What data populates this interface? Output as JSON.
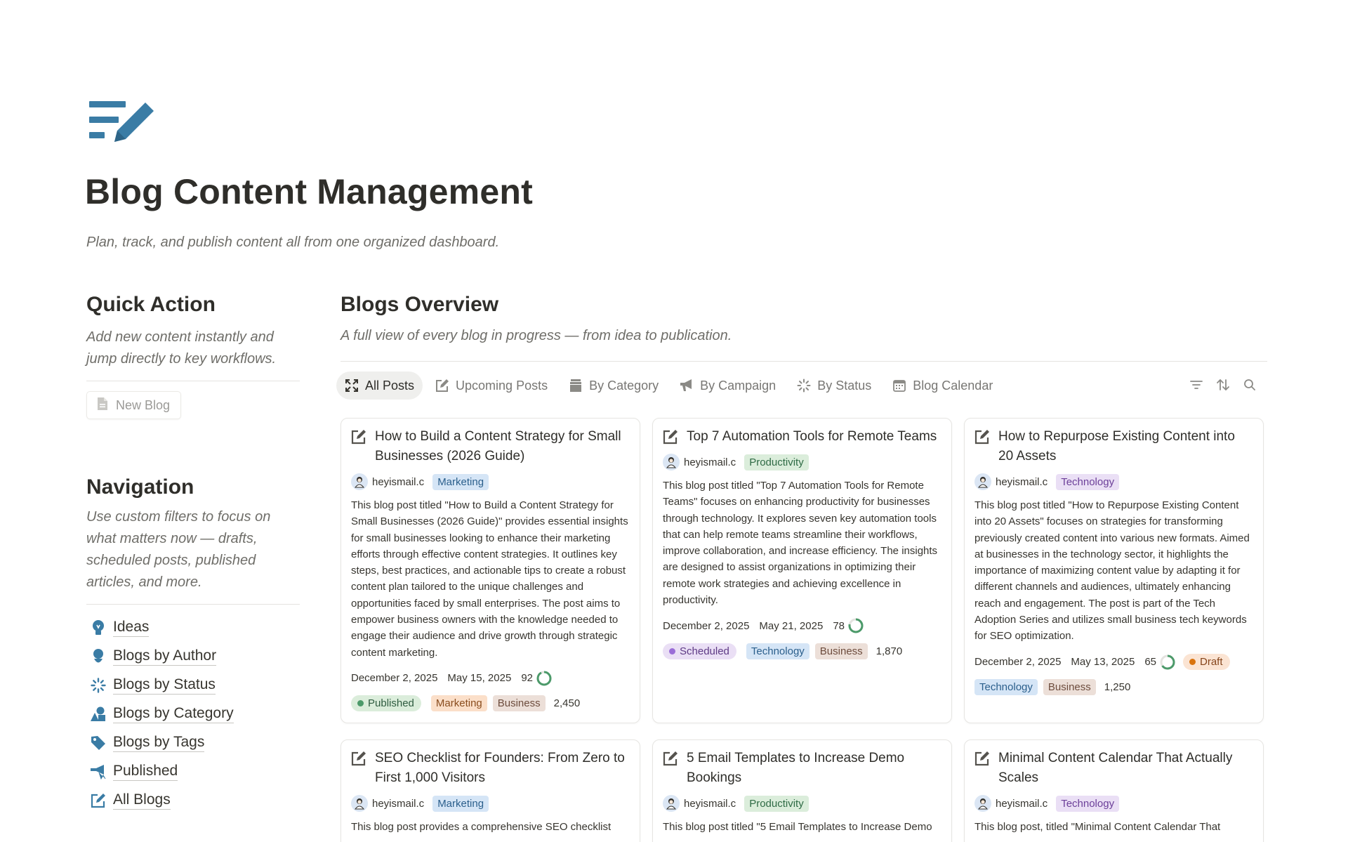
{
  "page": {
    "icon": "edit-list-icon",
    "title": "Blog Content Management",
    "subtitle": "Plan, track, and publish content all from one organized dashboard."
  },
  "quick_action": {
    "title": "Quick Action",
    "description": "Add new content instantly and jump directly to key workflows.",
    "new_blog_label": "New Blog"
  },
  "navigation": {
    "title": "Navigation",
    "description": "Use custom filters to focus on what matters now — drafts, scheduled posts, published articles, and more.",
    "items": [
      {
        "label": "Ideas",
        "icon": "lightbulb-icon"
      },
      {
        "label": "Blogs by Author",
        "icon": "person-icon"
      },
      {
        "label": "Blogs by Status",
        "icon": "loading-icon"
      },
      {
        "label": "Blogs by Category",
        "icon": "shapes-icon"
      },
      {
        "label": "Blogs by Tags",
        "icon": "tag-icon"
      },
      {
        "label": "Published",
        "icon": "megaphone-icon"
      },
      {
        "label": "All Blogs",
        "icon": "edit-icon"
      }
    ]
  },
  "overview": {
    "title": "Blogs Overview",
    "description": "A full view of every blog in progress — from idea to publication.",
    "tabs": [
      {
        "label": "All Posts",
        "icon": "expand-icon",
        "active": true
      },
      {
        "label": "Upcoming Posts",
        "icon": "edit-icon",
        "active": false
      },
      {
        "label": "By Category",
        "icon": "archive-icon",
        "active": false
      },
      {
        "label": "By Campaign",
        "icon": "megaphone-icon",
        "active": false
      },
      {
        "label": "By Status",
        "icon": "loading-icon",
        "active": false
      },
      {
        "label": "Blog Calendar",
        "icon": "calendar-icon",
        "active": false
      }
    ],
    "tools": [
      "filter-icon",
      "sort-icon",
      "search-icon"
    ]
  },
  "cards": [
    {
      "title": "How to Build a Content Strategy for Small Businesses (2026 Guide)",
      "author": "heyismail.c",
      "category": {
        "label": "Marketing",
        "color": "blue"
      },
      "body": "This blog post titled \"How to Build a Content Strategy for Small Businesses (2026 Guide)\" provides essential insights for small businesses looking to enhance their marketing efforts through effective content strategies. It outlines key steps, best practices, and actionable tips to create a robust content plan tailored to the unique challenges and opportunities faced by small enterprises. The post aims to empower business owners with the knowledge needed to engage their audience and drive growth through strategic content marketing.",
      "date1": "December 2, 2025",
      "date2": "May 15, 2025",
      "score": "92",
      "score_fraction": 0.92,
      "status": {
        "label": "Published",
        "kind": "published"
      },
      "tags": [
        {
          "label": "Marketing",
          "color": "orange"
        },
        {
          "label": "Business",
          "color": "brown"
        }
      ],
      "count": "2,450"
    },
    {
      "title": "Top 7 Automation Tools for Remote Teams",
      "author": "heyismail.c",
      "category": {
        "label": "Productivity",
        "color": "green"
      },
      "body": "This blog post titled \"Top 7 Automation Tools for Remote Teams\" focuses on enhancing productivity for businesses through technology. It explores seven key automation tools that can help remote teams streamline their workflows, improve collaboration, and increase efficiency. The insights are designed to assist organizations in optimizing their remote work strategies and achieving excellence in productivity.",
      "date1": "December 2, 2025",
      "date2": "May 21, 2025",
      "score": "78",
      "score_fraction": 0.78,
      "status": {
        "label": "Scheduled",
        "kind": "scheduled"
      },
      "tags": [
        {
          "label": "Technology",
          "color": "blue"
        },
        {
          "label": "Business",
          "color": "brown"
        }
      ],
      "count": "1,870"
    },
    {
      "title": "How to Repurpose Existing Content into 20 Assets",
      "author": "heyismail.c",
      "category": {
        "label": "Technology",
        "color": "purple"
      },
      "body": "This blog post titled \"How to Repurpose Existing Content into 20 Assets\" focuses on strategies for transforming previously created content into various new formats. Aimed at businesses in the technology sector, it highlights the importance of maximizing content value by adapting it for different channels and audiences, ultimately enhancing reach and engagement. The post is part of the Tech Adoption Series and utilizes small business tech keywords for SEO optimization.",
      "date1": "December 2, 2025",
      "date2": "May 13, 2025",
      "score": "65",
      "score_fraction": 0.65,
      "status": {
        "label": "Draft",
        "kind": "draft"
      },
      "tags": [
        {
          "label": "Technology",
          "color": "blue"
        },
        {
          "label": "Business",
          "color": "brown"
        }
      ],
      "count": "1,250"
    },
    {
      "title": "SEO Checklist for Founders: From Zero to First 1,000 Visitors",
      "author": "heyismail.c",
      "category": {
        "label": "Marketing",
        "color": "blue"
      },
      "body": "This blog post provides a comprehensive SEO checklist"
    },
    {
      "title": "5 Email Templates to Increase Demo Bookings",
      "author": "heyismail.c",
      "category": {
        "label": "Productivity",
        "color": "green"
      },
      "body": "This blog post titled \"5 Email Templates to Increase Demo"
    },
    {
      "title": "Minimal Content Calendar That Actually Scales",
      "author": "heyismail.c",
      "category": {
        "label": "Technology",
        "color": "purple"
      },
      "body": "This blog post, titled \"Minimal Content Calendar That"
    }
  ],
  "colors": {
    "accent": "#3a7ca5",
    "ring": "#4c9a6a"
  }
}
